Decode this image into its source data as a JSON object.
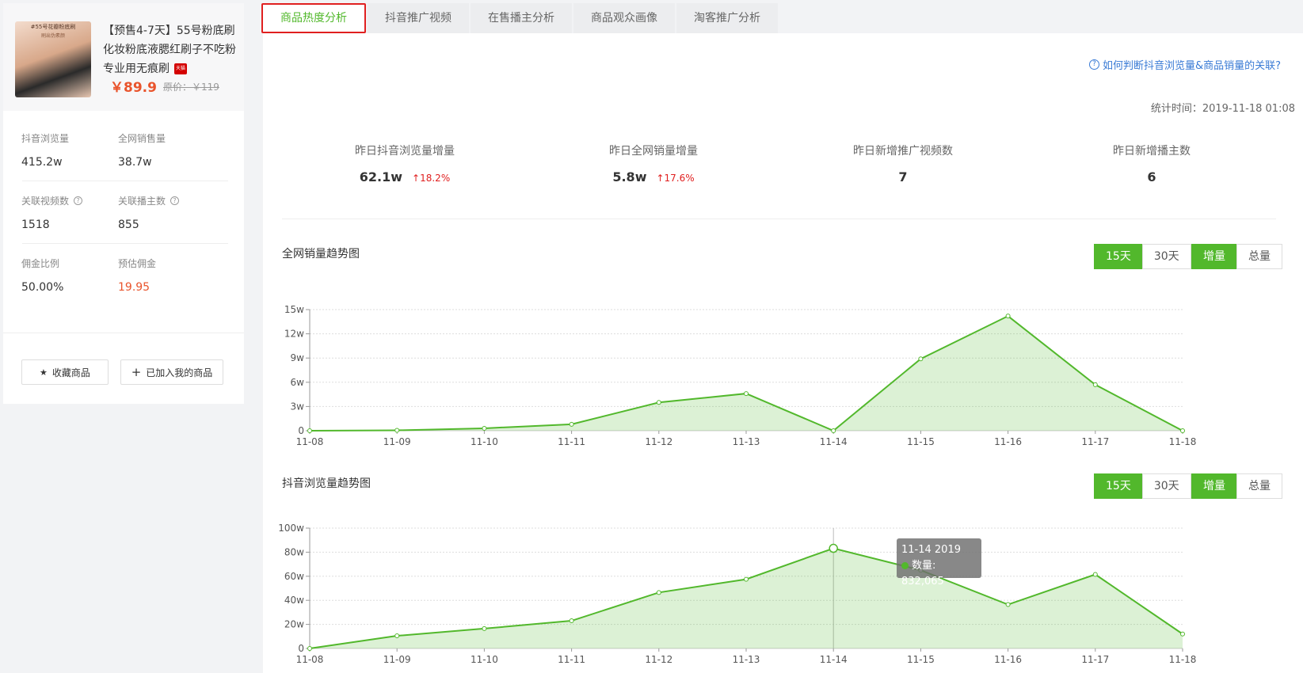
{
  "product": {
    "image_caption": "#55号花瓣粉底刷",
    "image_caption2": "刷出伪素颜",
    "title": "【预售4-7天】55号粉底刷化妆粉底液腮红刷子不吃粉专业用无痕刷",
    "badge": "天猫",
    "price": "￥89.9",
    "original_price": "原价：￥119"
  },
  "stats": [
    {
      "label": "抖音浏览量",
      "value": "415.2w"
    },
    {
      "label": "全网销售量",
      "value": "38.7w"
    },
    {
      "label": "关联视频数",
      "value": "1518"
    },
    {
      "label": "关联播主数",
      "value": "855"
    },
    {
      "label": "佣金比例",
      "value": "50.00%"
    },
    {
      "label": "预估佣金",
      "value": "19.95"
    }
  ],
  "actions": {
    "favorite": "收藏商品",
    "added": "已加入我的商品"
  },
  "tabs": [
    "商品热度分析",
    "抖音推广视频",
    "在售播主分析",
    "商品观众画像",
    "淘客推广分析"
  ],
  "help_link": "如何判断抖音浏览量&商品销量的关联?",
  "stat_time": "统计时间：2019-11-18 01:08",
  "kpis": [
    {
      "label": "昨日抖音浏览量增量",
      "value": "62.1w",
      "change": "18.2%"
    },
    {
      "label": "昨日全网销量增量",
      "value": "5.8w",
      "change": "17.6%"
    },
    {
      "label": "昨日新增推广视频数",
      "value": "7",
      "change": ""
    },
    {
      "label": "昨日新增播主数",
      "value": "6",
      "change": ""
    }
  ],
  "controls": {
    "days15": "15天",
    "days30": "30天",
    "increment": "增量",
    "total": "总量"
  },
  "colors": {
    "accent": "#52b82c",
    "price": "#e9542c",
    "up": "#e02020",
    "link": "#3a7bd5"
  },
  "tooltip": {
    "title": "11-14 2019",
    "label": "数量: 832,065"
  },
  "chart_data": [
    {
      "type": "area",
      "title": "全网销量趋势图",
      "x": [
        "11-08",
        "11-09",
        "11-10",
        "11-11",
        "11-12",
        "11-13",
        "11-14",
        "11-15",
        "11-16",
        "11-17",
        "11-18"
      ],
      "values": [
        0,
        500,
        3000,
        8000,
        35000,
        46000,
        0,
        89000,
        142000,
        57000,
        0
      ],
      "ylim": [
        0,
        150000
      ],
      "yticks": [
        0,
        30000,
        60000,
        90000,
        120000,
        150000
      ],
      "ytick_labels": [
        "0",
        "3w",
        "6w",
        "9w",
        "12w",
        "15w"
      ],
      "grid": true
    },
    {
      "type": "area",
      "title": "抖音浏览量趋势图",
      "x": [
        "11-08",
        "11-09",
        "11-10",
        "11-11",
        "11-12",
        "11-13",
        "11-14",
        "11-15",
        "11-16",
        "11-17",
        "11-18"
      ],
      "values": [
        0,
        105000,
        165000,
        230000,
        465000,
        575000,
        832065,
        650000,
        365000,
        615000,
        120000
      ],
      "ylim": [
        0,
        1000000
      ],
      "yticks": [
        0,
        200000,
        400000,
        600000,
        800000,
        1000000
      ],
      "ytick_labels": [
        "0",
        "20w",
        "40w",
        "60w",
        "80w",
        "100w"
      ],
      "grid": true,
      "highlight_index": 6
    }
  ]
}
